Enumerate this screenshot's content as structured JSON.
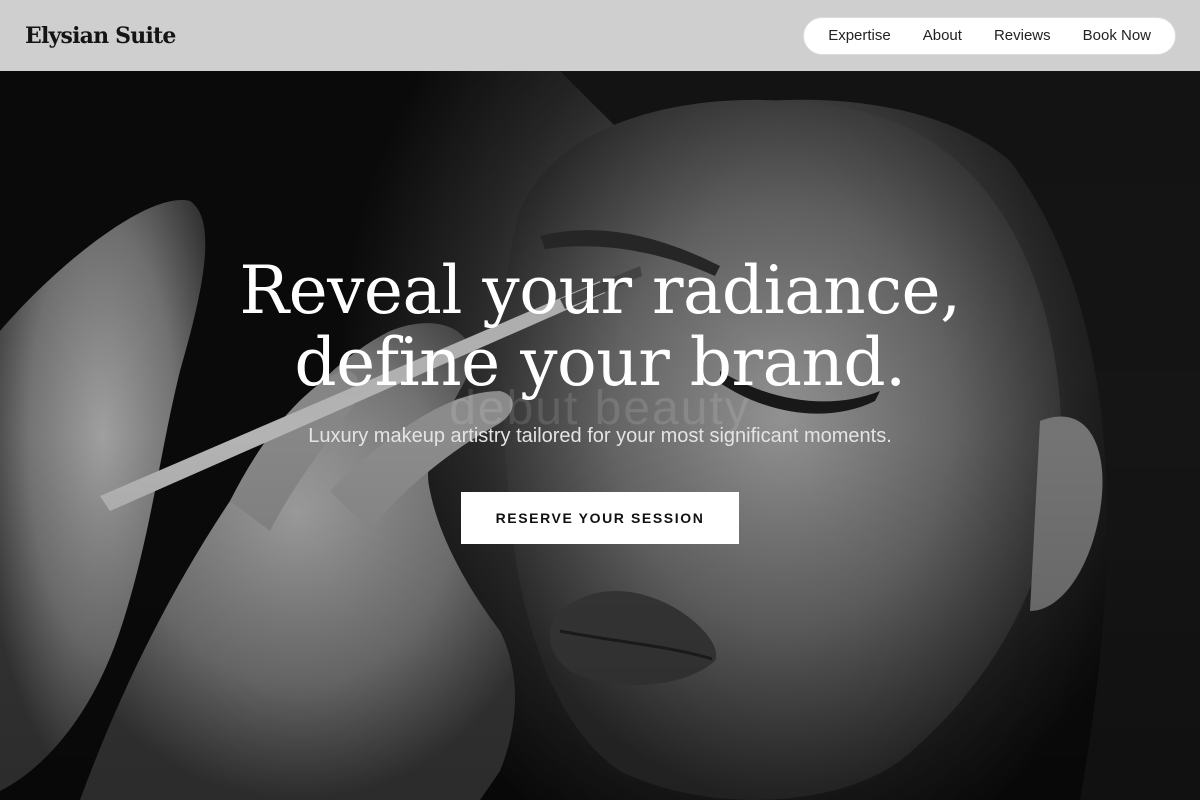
{
  "header": {
    "brand": "Elysian Suite",
    "nav": [
      {
        "label": "Expertise"
      },
      {
        "label": "About"
      },
      {
        "label": "Reviews"
      },
      {
        "label": "Book Now"
      }
    ]
  },
  "hero": {
    "headline_line1": "Reveal your radiance,",
    "headline_line2": "define your brand.",
    "watermark": "debut beauty",
    "subtitle": "Luxury makeup artistry tailored for your most significant moments.",
    "cta_label": "RESERVE YOUR SESSION"
  },
  "colors": {
    "header_bg": "#cfcfcf",
    "cta_bg": "#ffffff",
    "headline": "#ffffff"
  }
}
